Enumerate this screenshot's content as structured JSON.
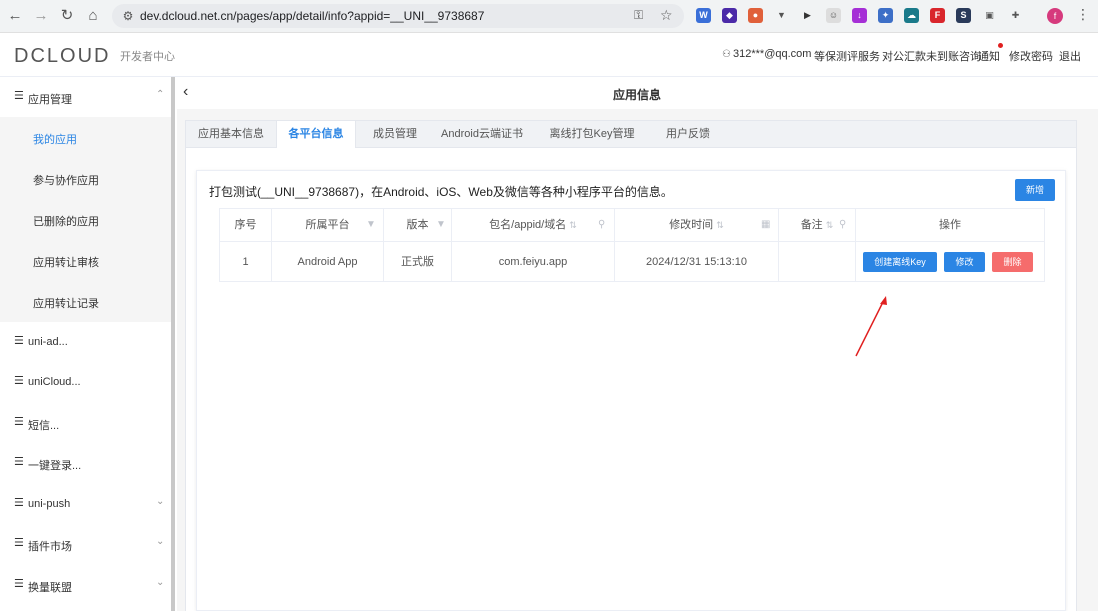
{
  "browser": {
    "url": "dev.dcloud.net.cn/pages/app/detail/info?appid=__UNI__9738687",
    "profile_initial": "f"
  },
  "header": {
    "logo_text": "DCLOUD",
    "subtitle": "开发者中心",
    "user": "312***@qq.com",
    "links": [
      "等保测评服务",
      "对公汇款未到账咨询",
      "通知",
      "修改密码",
      "退出"
    ]
  },
  "sidebar": {
    "groups": [
      {
        "label": "应用管理",
        "expanded": true
      },
      {
        "label": "uni-ad..."
      },
      {
        "label": "uniCloud..."
      },
      {
        "label": "短信..."
      },
      {
        "label": "一键登录..."
      },
      {
        "label": "uni-push"
      },
      {
        "label": "插件市场"
      },
      {
        "label": "换量联盟"
      }
    ],
    "sub_items": [
      "我的应用",
      "参与协作应用",
      "已删除的应用",
      "应用转让审核",
      "应用转让记录"
    ],
    "active_sub": "我的应用"
  },
  "page": {
    "title": "应用信息",
    "tabs": [
      "应用基本信息",
      "各平台信息",
      "成员管理",
      "Android云端证书",
      "离线打包Key管理",
      "用户反馈"
    ],
    "active_tab": "各平台信息",
    "card_title": "打包测试(__UNI__9738687)，在Android、iOS、Web及微信等各种小程序平台的信息。",
    "add_button": "新增"
  },
  "table": {
    "columns": [
      "序号",
      "所属平台",
      "版本",
      "包名/appid/域名",
      "修改时间",
      "备注",
      "操作"
    ],
    "rows": [
      {
        "index": "1",
        "platform": "Android App",
        "version": "正式版",
        "package": "com.feiyu.app",
        "modified": "2024/12/31 15:13:10",
        "note": "",
        "actions": [
          "创建离线Key",
          "修改",
          "删除"
        ]
      }
    ]
  },
  "colors": {
    "accent": "#2b85e4",
    "danger": "#f56c6c",
    "annotation_arrow": "#e02020"
  }
}
